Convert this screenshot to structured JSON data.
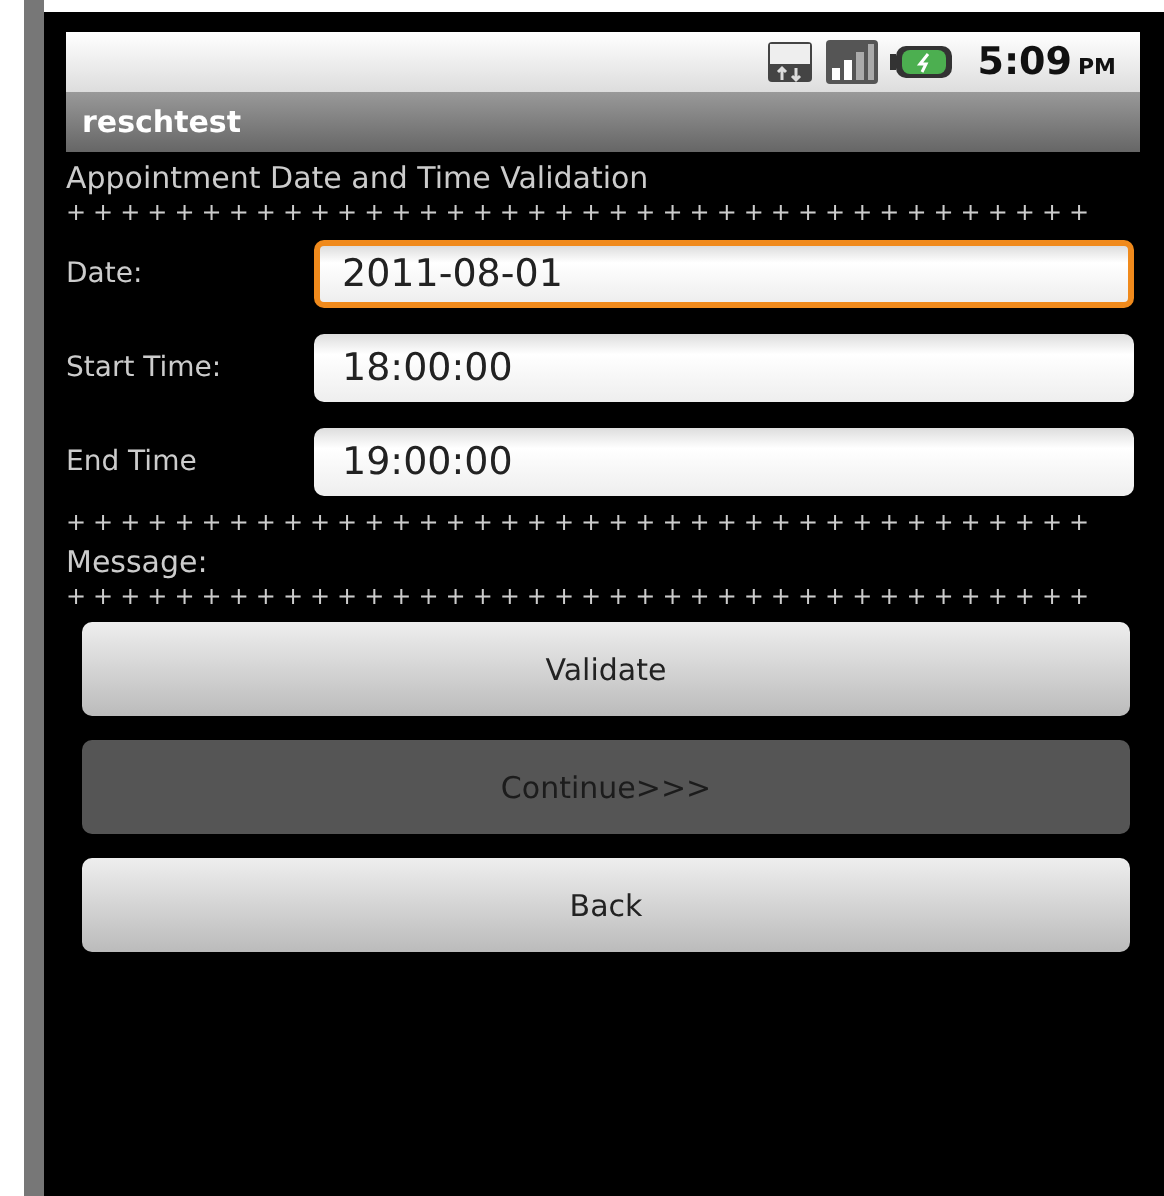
{
  "status_bar": {
    "time": "5:09",
    "ampm": "PM"
  },
  "window": {
    "title": "reschtest"
  },
  "heading": "Appointment Date and Time Validation",
  "separator_1": "++++++++++++++++++++++++++++++++++++++",
  "fields": [
    {
      "label": "Date:",
      "value": "2011-08-01",
      "focused": true
    },
    {
      "label": "Start Time:",
      "value": "18:00:00",
      "focused": false
    },
    {
      "label": "End Time",
      "value": "19:00:00",
      "focused": false
    }
  ],
  "separator_2": "++++++++++++++++++++++++++++++++++++++",
  "message_label": "Message:",
  "separator_3": "++++++++++++++++++++++++++++++++++++++",
  "buttons": [
    {
      "label": "Validate",
      "disabled": false
    },
    {
      "label": "Continue>>>",
      "disabled": true
    },
    {
      "label": "Back",
      "disabled": false
    }
  ]
}
